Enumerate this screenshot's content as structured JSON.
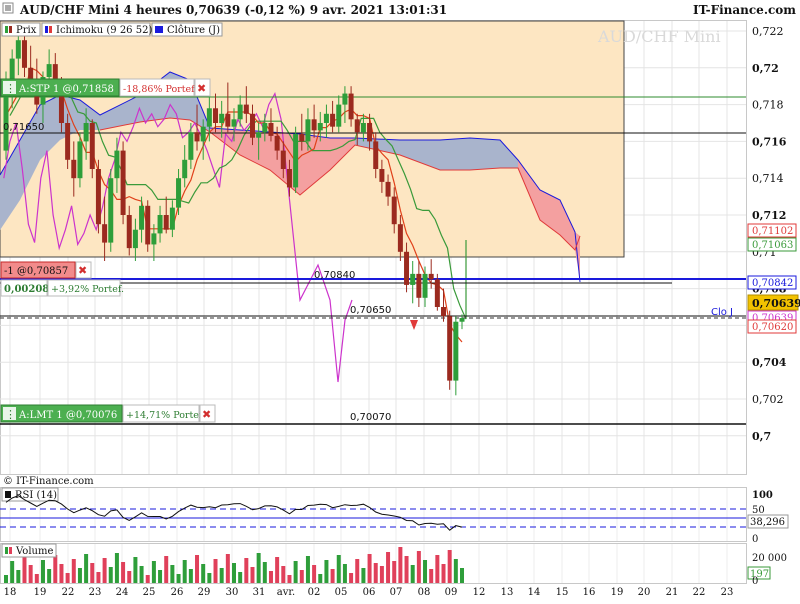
{
  "header": {
    "title": "AUD/CHF Mini 4 heures 0,70639 (-0,12 %) 9 avr. 2021 13:01:31",
    "brand": "IT-Finance.com",
    "watermark": "AUD/CHF Mini",
    "copyright": "© IT-Finance.com"
  },
  "legend": {
    "items": [
      "Prix",
      "Ichimoku (9 26 52)",
      "Clôture (J)"
    ]
  },
  "orders": {
    "stop": {
      "label": "A:STP  1 @0,71858",
      "pnl": "-18,86% Portef."
    },
    "position": {
      "label": "-1 @0,70857",
      "points": "0,00208",
      "pnl": "+3,92% Portef."
    },
    "limit": {
      "label": "A:LMT  1 @0,70076",
      "pnl": "+14,71% Portef."
    },
    "close_glyph": "✖"
  },
  "level_labels": {
    "l71650": "0,71650",
    "l70840": "0,70840",
    "l70650": "0,70650",
    "l70070": "0,70070",
    "clo_j": "Clo J"
  },
  "price_axis": {
    "ticks": [
      "0,722",
      "0,72",
      "0,718",
      "0,716",
      "0,714",
      "0,712",
      "0,71",
      "0,708",
      "0,706",
      "0,704",
      "0,702",
      "0,7"
    ],
    "tick_values": [
      0.722,
      0.72,
      0.718,
      0.716,
      0.714,
      0.712,
      0.71,
      0.708,
      0.706,
      0.704,
      0.702,
      0.7
    ],
    "badges": {
      "b71102": "0,71102",
      "b71063": "0,71063",
      "b70842": "0,70842",
      "b70639a": "0,70639",
      "b70639": "0,70639",
      "b70620": "0,70620"
    }
  },
  "x_axis": {
    "labels": [
      "18",
      "19",
      "22",
      "23",
      "24",
      "25",
      "26",
      "29",
      "30",
      "31",
      "avr.",
      "02",
      "05",
      "06",
      "07",
      "08",
      "09",
      "12",
      "13",
      "14",
      "15",
      "16",
      "19",
      "20",
      "21",
      "22",
      "23"
    ]
  },
  "rsi": {
    "label": "RSI (14)",
    "levels": [
      "100",
      "50",
      "0"
    ],
    "value": "38,296"
  },
  "volume": {
    "label": "Volume",
    "levels": [
      "20 000",
      "0"
    ],
    "value": "197"
  },
  "colors": {
    "up": "#2e9e3a",
    "down": "#9b2a1f",
    "cloud_red": "#f4a0a0",
    "cloud_blue": "#a9b4cc",
    "zone": "#fde6c2",
    "chikou": "#cc33cc",
    "tenkan": "#e0401a",
    "kijun": "#3a9a3a",
    "volume_up": "#2e9e3a",
    "volume_down": "#e0405a"
  },
  "chart_data": {
    "type": "candlestick",
    "title": "AUD/CHF Mini 4 heures 0,70639 (-0,12 %) 9 avr. 2021 13:01:31",
    "ylim": [
      0.7,
      0.7225
    ],
    "candles": [
      [
        0.7155,
        0.7198,
        0.715,
        0.719
      ],
      [
        0.719,
        0.721,
        0.7178,
        0.7205
      ],
      [
        0.7205,
        0.7222,
        0.7196,
        0.7215
      ],
      [
        0.7215,
        0.722,
        0.7195,
        0.72
      ],
      [
        0.72,
        0.7212,
        0.7185,
        0.7192
      ],
      [
        0.7192,
        0.7205,
        0.7175,
        0.718
      ],
      [
        0.718,
        0.7198,
        0.717,
        0.7195
      ],
      [
        0.7195,
        0.721,
        0.7188,
        0.7202
      ],
      [
        0.7202,
        0.7208,
        0.7185,
        0.719
      ],
      [
        0.719,
        0.7195,
        0.7165,
        0.717
      ],
      [
        0.717,
        0.7175,
        0.7145,
        0.715
      ],
      [
        0.715,
        0.716,
        0.713,
        0.714
      ],
      [
        0.714,
        0.7165,
        0.7135,
        0.716
      ],
      [
        0.716,
        0.7178,
        0.715,
        0.717
      ],
      [
        0.717,
        0.7172,
        0.714,
        0.7145
      ],
      [
        0.7145,
        0.715,
        0.711,
        0.7115
      ],
      [
        0.7115,
        0.713,
        0.7095,
        0.7105
      ],
      [
        0.7105,
        0.7145,
        0.71,
        0.714
      ],
      [
        0.714,
        0.7162,
        0.7132,
        0.7155
      ],
      [
        0.7155,
        0.716,
        0.7115,
        0.712
      ],
      [
        0.712,
        0.7125,
        0.7098,
        0.7102
      ],
      [
        0.7102,
        0.7118,
        0.7095,
        0.7112
      ],
      [
        0.7112,
        0.713,
        0.7105,
        0.7125
      ],
      [
        0.7125,
        0.7128,
        0.71,
        0.7104
      ],
      [
        0.7104,
        0.7115,
        0.7095,
        0.711
      ],
      [
        0.711,
        0.7125,
        0.7105,
        0.712
      ],
      [
        0.712,
        0.713,
        0.711,
        0.7112
      ],
      [
        0.7112,
        0.7128,
        0.7108,
        0.7124
      ],
      [
        0.7124,
        0.7145,
        0.712,
        0.714
      ],
      [
        0.714,
        0.7158,
        0.7135,
        0.715
      ],
      [
        0.715,
        0.717,
        0.7145,
        0.7165
      ],
      [
        0.7165,
        0.718,
        0.7155,
        0.716
      ],
      [
        0.716,
        0.7172,
        0.715,
        0.7168
      ],
      [
        0.7168,
        0.7185,
        0.716,
        0.7178
      ],
      [
        0.7178,
        0.7186,
        0.7165,
        0.717
      ],
      [
        0.717,
        0.7182,
        0.7162,
        0.7175
      ],
      [
        0.7175,
        0.7192,
        0.7165,
        0.7168
      ],
      [
        0.7168,
        0.7178,
        0.716,
        0.7172
      ],
      [
        0.7172,
        0.7185,
        0.7168,
        0.718
      ],
      [
        0.718,
        0.719,
        0.717,
        0.7175
      ],
      [
        0.7175,
        0.718,
        0.7158,
        0.7162
      ],
      [
        0.7162,
        0.717,
        0.715,
        0.7165
      ],
      [
        0.7165,
        0.7175,
        0.716,
        0.717
      ],
      [
        0.717,
        0.7178,
        0.716,
        0.7163
      ],
      [
        0.7163,
        0.7168,
        0.715,
        0.7155
      ],
      [
        0.7155,
        0.716,
        0.714,
        0.7145
      ],
      [
        0.7145,
        0.715,
        0.713,
        0.7135
      ],
      [
        0.7135,
        0.7168,
        0.7132,
        0.7164
      ],
      [
        0.7164,
        0.7175,
        0.7155,
        0.716
      ],
      [
        0.716,
        0.7178,
        0.7155,
        0.7172
      ],
      [
        0.7172,
        0.718,
        0.7162,
        0.7166
      ],
      [
        0.7166,
        0.7176,
        0.716,
        0.717
      ],
      [
        0.717,
        0.718,
        0.7162,
        0.7175
      ],
      [
        0.7175,
        0.7182,
        0.7165,
        0.7168
      ],
      [
        0.7168,
        0.7185,
        0.7165,
        0.718
      ],
      [
        0.718,
        0.719,
        0.717,
        0.7186
      ],
      [
        0.7186,
        0.719,
        0.7168,
        0.7172
      ],
      [
        0.7172,
        0.7175,
        0.7158,
        0.7165
      ],
      [
        0.7165,
        0.7175,
        0.716,
        0.717
      ],
      [
        0.717,
        0.7175,
        0.7155,
        0.716
      ],
      [
        0.716,
        0.7165,
        0.714,
        0.7145
      ],
      [
        0.7145,
        0.715,
        0.7132,
        0.7138
      ],
      [
        0.7138,
        0.7142,
        0.7125,
        0.713
      ],
      [
        0.713,
        0.7135,
        0.711,
        0.7115
      ],
      [
        0.7115,
        0.712,
        0.7095,
        0.71
      ],
      [
        0.71,
        0.7105,
        0.7078,
        0.7082
      ],
      [
        0.7082,
        0.7095,
        0.7072,
        0.7088
      ],
      [
        0.7088,
        0.7095,
        0.707,
        0.7075
      ],
      [
        0.7075,
        0.7092,
        0.707,
        0.7088
      ],
      [
        0.7088,
        0.7096,
        0.708,
        0.7085
      ],
      [
        0.7085,
        0.7088,
        0.7068,
        0.707
      ],
      [
        0.707,
        0.708,
        0.7062,
        0.7065
      ],
      [
        0.7065,
        0.7068,
        0.7025,
        0.703
      ],
      [
        0.703,
        0.7065,
        0.7022,
        0.7062
      ],
      [
        0.7062,
        0.7066,
        0.7058,
        0.7064
      ]
    ],
    "levels": {
      "stop_order": 0.71858,
      "level_71650": 0.7165,
      "position_open": 0.70857,
      "level_70840": 0.7084,
      "level_70650": 0.7065,
      "limit_order": 0.70076,
      "level_70070": 0.7007,
      "ichimoku_blue": 0.70842,
      "last_price": 0.70639,
      "daily_close": 0.70639
    }
  }
}
